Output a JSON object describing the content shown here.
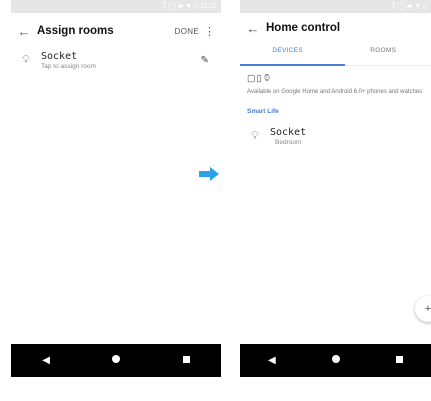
{
  "left": {
    "status_text": "⁑ ◯ ▰ ▼ ▯ 11:22",
    "title": "Assign rooms",
    "done_label": "DONE",
    "device": {
      "name": "Socket",
      "subtitle": "Tap to assign room"
    }
  },
  "right": {
    "status_text": "⁑ ◯ ▰ ▼ ▯",
    "title": "Home control",
    "tabs": [
      {
        "label": "DEVICES",
        "active": true
      },
      {
        "label": "ROOMS",
        "active": false
      }
    ],
    "availability_text": "Available on Google Home and Android 6.0+ phones and watches",
    "section_label": "Smart Life",
    "device": {
      "name": "Socket",
      "room": "Bedroom"
    }
  },
  "colors": {
    "accent": "#4a7ed8",
    "arrow": "#2aa0e6",
    "status_bar": "#e6e6e6",
    "nav_bar": "#000000"
  },
  "icons": [
    "back-arrow-icon",
    "more-vert-icon",
    "lightbulb-icon",
    "pencil-icon",
    "speaker-icon",
    "tablet-icon",
    "watch-icon",
    "add-icon",
    "back-nav-icon",
    "home-nav-icon",
    "recents-nav-icon",
    "right-arrow-icon"
  ]
}
